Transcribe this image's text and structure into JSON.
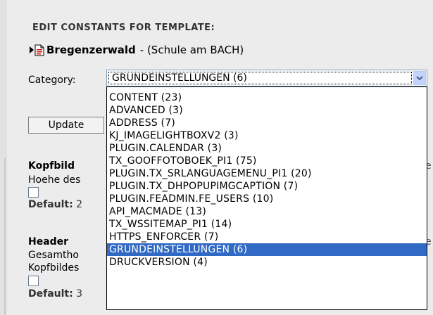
{
  "heading": "EDIT CONSTANTS FOR TEMPLATE:",
  "page": {
    "title": "Bregenzerwald",
    "subtitle": "- (Schule am BACH)"
  },
  "category": {
    "label": "Category:",
    "selected_value": "GRUNDEINSTELLUNGEN (6)",
    "options": [
      "CONTENT (23)",
      "ADVANCED (3)",
      "ADDRESS (7)",
      "KJ_IMAGELIGHTBOXV2 (3)",
      "PLUGIN.CALENDAR (3)",
      "TX_GOOFFOTOBOEK_PI1 (75)",
      "PLUGIN.TX_SRLANGUAGEMENU_PI1 (20)",
      "PLUGIN.TX_DHPOPUPIMGCAPTION (7)",
      "PLUGIN.FEADMIN.FE_USERS (10)",
      "API_MACMADE (13)",
      "TX_WSSITEMAP_PI1 (14)",
      "HTTPS_ENFORCER (7)",
      "GRUNDEINSTELLUNGEN (6)",
      "DRUCKVERSION (4)"
    ],
    "selected_index": 12
  },
  "update_button": "Update",
  "fields": [
    {
      "title": "Kopfbild",
      "desc": "Hoehe des",
      "default_label": "Default:",
      "default_value": "2",
      "edge": "e"
    },
    {
      "title": "Header",
      "desc": "Gesamtho",
      "desc2": "Kopfbildes",
      "default_label": "Default:",
      "default_value": "3",
      "edge": "e"
    }
  ],
  "colors": {
    "selection": "#316ac5",
    "background": "#ececec"
  }
}
